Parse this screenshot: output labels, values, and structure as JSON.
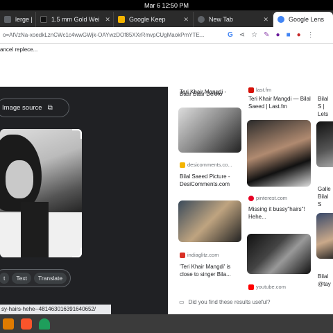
{
  "system": {
    "datetime": "Mar 6  12:50 PM"
  },
  "tabs": [
    {
      "label": "lerge | ",
      "icon": "tab-favicon",
      "color": "#5f6368"
    },
    {
      "label": "1.5 mm Gold Wei",
      "icon": "tab-favicon",
      "color": "#111111"
    },
    {
      "label": "Google Keep",
      "icon": "keep-icon",
      "color": "#f4b400"
    },
    {
      "label": "New Tab",
      "icon": "chrome-icon",
      "color": "#5f6368"
    },
    {
      "label": "Google Lens",
      "icon": "google-icon",
      "color": "#4285f4",
      "active": true
    }
  ],
  "address": {
    "url": "o=AfVzNa-xoedkLznCWc1c4wwGWjk-OAYwzDOf85XXrRmvpCUgMaokPmYTE..."
  },
  "toolbar2": {
    "text": "ancel replece..."
  },
  "left": {
    "image_source_label": "Image source",
    "actions": [
      "t",
      "Text",
      "Translate"
    ],
    "status_url": "sy-hairs-hehe--481463016391640652/"
  },
  "results": {
    "col1": [
      {
        "title": "Teri Khair Mangdi - Bilal Saeed | Last.fm"
      },
      {
        "source": "desicomments.co...",
        "title": "Bilal Saeed Picture - DesiComments.com"
      },
      {
        "source": "indiaglitz.com",
        "title": "'Teri Khair Mangdi' is close to singer Bila..."
      }
    ],
    "top_title": "Teri Khair Mangdi - Bilal Saeed | Last.fm",
    "top_caption": "Baar Baar Dekho",
    "col2": [
      {
        "source": "last.fm",
        "title": "Teri Khair Mangdi — Bilal Saeed | Last.fm"
      },
      {
        "source": "pinterest.com",
        "title": "Missing it bussy\"hairs\"! Hehe..."
      },
      {
        "source": "youtube.com"
      }
    ],
    "col3": [
      {
        "title": "Bilal S | Lets"
      },
      {
        "title": "Galle Bilal S"
      },
      {
        "title": "Bilal @tay"
      }
    ],
    "top_left_snippet": "Teri Khair Mangdi -",
    "feedback": "Did you find these results useful?"
  }
}
